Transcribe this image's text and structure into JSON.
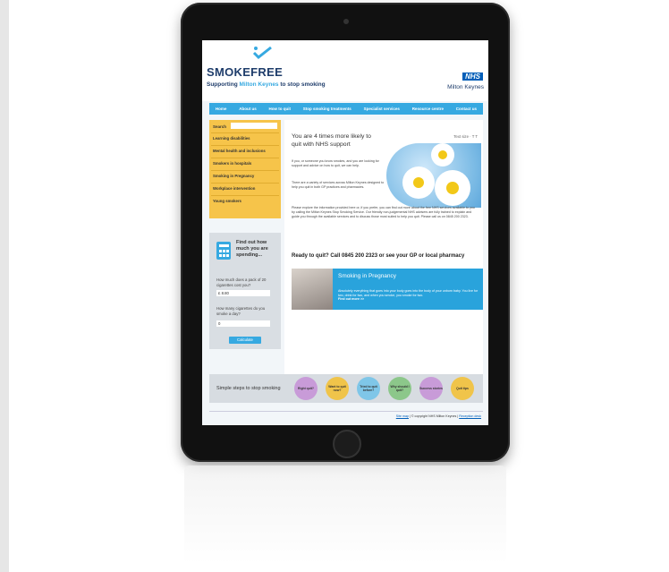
{
  "header": {
    "brand": "SMOKEFREE",
    "tagline_prefix": "Supporting",
    "tagline_highlight": "Milton Keynes",
    "tagline_suffix": "to stop smoking",
    "nhs_logo": "NHS",
    "org_name": "Milton Keynes"
  },
  "nav": {
    "items": [
      "Home",
      "About us",
      "How to quit",
      "Stop smoking treatments",
      "Specialist services",
      "Resource centre",
      "Contact us"
    ]
  },
  "sidebar": {
    "search_label": "Search",
    "items": [
      "Learning disabilities",
      "Mental health and inclusions",
      "Smokers in hospitals",
      "Smoking in Pregnancy",
      "Workplace intervention",
      "Young smokers"
    ]
  },
  "calculator": {
    "title": "Find out how much you are spending...",
    "q1": "How much does a pack of 20 cigarettes cost you?",
    "q1_value": "£ 8.80",
    "q2": "How many cigarettes do you smoke a day?",
    "q2_value": "0",
    "button": "Calculate"
  },
  "content": {
    "headline": "You are 4 times more likely to quit with NHS support",
    "text_size": "Text size",
    "para1": "If you, or someone you know smokes, and you are looking for support and advice on how to quit, we can help.",
    "para2": "There are a variety of services across Milton Keynes designed to help you quit in both GP practices and pharmacies.",
    "para3": "Please explore the information provided here or, if you prefer, you can find out more about the free NHS services available to you by calling the Milton Keynes Stop Smoking Service. Our friendly non-judgemental NHS advisers are fully trained to explain and guide you through the available services and to discuss those most suited to help you quit. Please call us on 0845 200 2323.",
    "cta": "Ready to quit? Call 0845 200 2323 or see your GP or local pharmacy"
  },
  "banner": {
    "title": "Smoking in Pregnancy",
    "text": "Absolutely everything that goes into your body goes into the body of your unborn baby. You live for two, drink for two, and when you smoke, you smoke for two.",
    "link": "Find out more >>"
  },
  "steps": {
    "label": "Simple steps to stop smoking",
    "items": [
      {
        "label": "Right quit?",
        "color": "#c89bd8"
      },
      {
        "label": "Want to quit now?",
        "color": "#f0c44a"
      },
      {
        "label": "Tried to quit before?",
        "color": "#7fc6e8"
      },
      {
        "label": "Why should I quit?",
        "color": "#8cc78a"
      },
      {
        "label": "Success stories",
        "color": "#c89bd8"
      },
      {
        "label": "Quit tips",
        "color": "#f0c44a"
      }
    ]
  },
  "footer": {
    "sitemap": "Site map",
    "copyright": "| © copyright NHS Milton Keynes |",
    "privacy": "Reception desk"
  }
}
